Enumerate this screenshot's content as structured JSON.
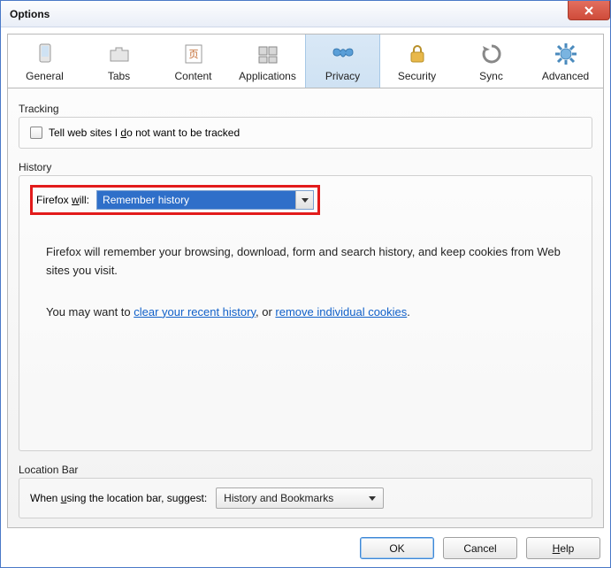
{
  "window": {
    "title": "Options"
  },
  "tabs": {
    "general": "General",
    "tabs": "Tabs",
    "content": "Content",
    "applications": "Applications",
    "privacy": "Privacy",
    "security": "Security",
    "sync": "Sync",
    "advanced": "Advanced"
  },
  "tracking": {
    "section": "Tracking",
    "checkbox_pre": "Tell web sites I ",
    "checkbox_u": "d",
    "checkbox_post": "o not want to be tracked"
  },
  "history": {
    "section": "History",
    "label_pre": "Firefox ",
    "label_u": "w",
    "label_post": "ill:",
    "dropdown_value": "Remember history",
    "desc1": "Firefox will remember your browsing, download, form and search history, and keep cookies from Web sites you visit.",
    "desc2_pre": "You may want to ",
    "link_clear": "clear your recent history",
    "desc2_mid": ", or ",
    "link_remove": "remove individual cookies",
    "desc2_post": "."
  },
  "location": {
    "section": "Location Bar",
    "label_pre": "When ",
    "label_u": "u",
    "label_post": "sing the location bar, suggest:",
    "dropdown_value": "History and Bookmarks"
  },
  "buttons": {
    "ok": "OK",
    "cancel": "Cancel",
    "help_u": "H",
    "help_post": "elp"
  }
}
